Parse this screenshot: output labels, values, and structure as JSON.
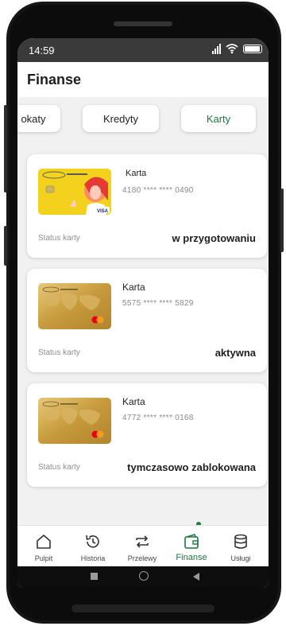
{
  "status_bar": {
    "time": "14:59"
  },
  "header": {
    "title": "Finanse"
  },
  "tabs": [
    {
      "label": "okaty"
    },
    {
      "label": "Kredyty"
    },
    {
      "label": "Karty"
    }
  ],
  "cards": [
    {
      "type": "Karta",
      "number": "4180 **** **** 0490",
      "status_label": "Status karty",
      "status": "w przygotowaniu",
      "design": "visa-yellow"
    },
    {
      "type": "Karta",
      "number": "5575 **** **** 5829",
      "status_label": "Status karty",
      "status": "aktywna",
      "design": "gold-mastercard"
    },
    {
      "type": "Karta",
      "number": "4772 **** **** 0168",
      "status_label": "Status karty",
      "status": "tymczasowo zablokowana",
      "design": "gold-mastercard"
    }
  ],
  "nav": [
    {
      "label": "Pulpit",
      "icon": "home-icon"
    },
    {
      "label": "Historia",
      "icon": "history-icon"
    },
    {
      "label": "Przelewy",
      "icon": "transfer-icon"
    },
    {
      "label": "Finanse",
      "icon": "wallet-icon",
      "active": true
    },
    {
      "label": "Usługi",
      "icon": "services-icon"
    }
  ],
  "colors": {
    "accent": "#1a7a3e"
  }
}
